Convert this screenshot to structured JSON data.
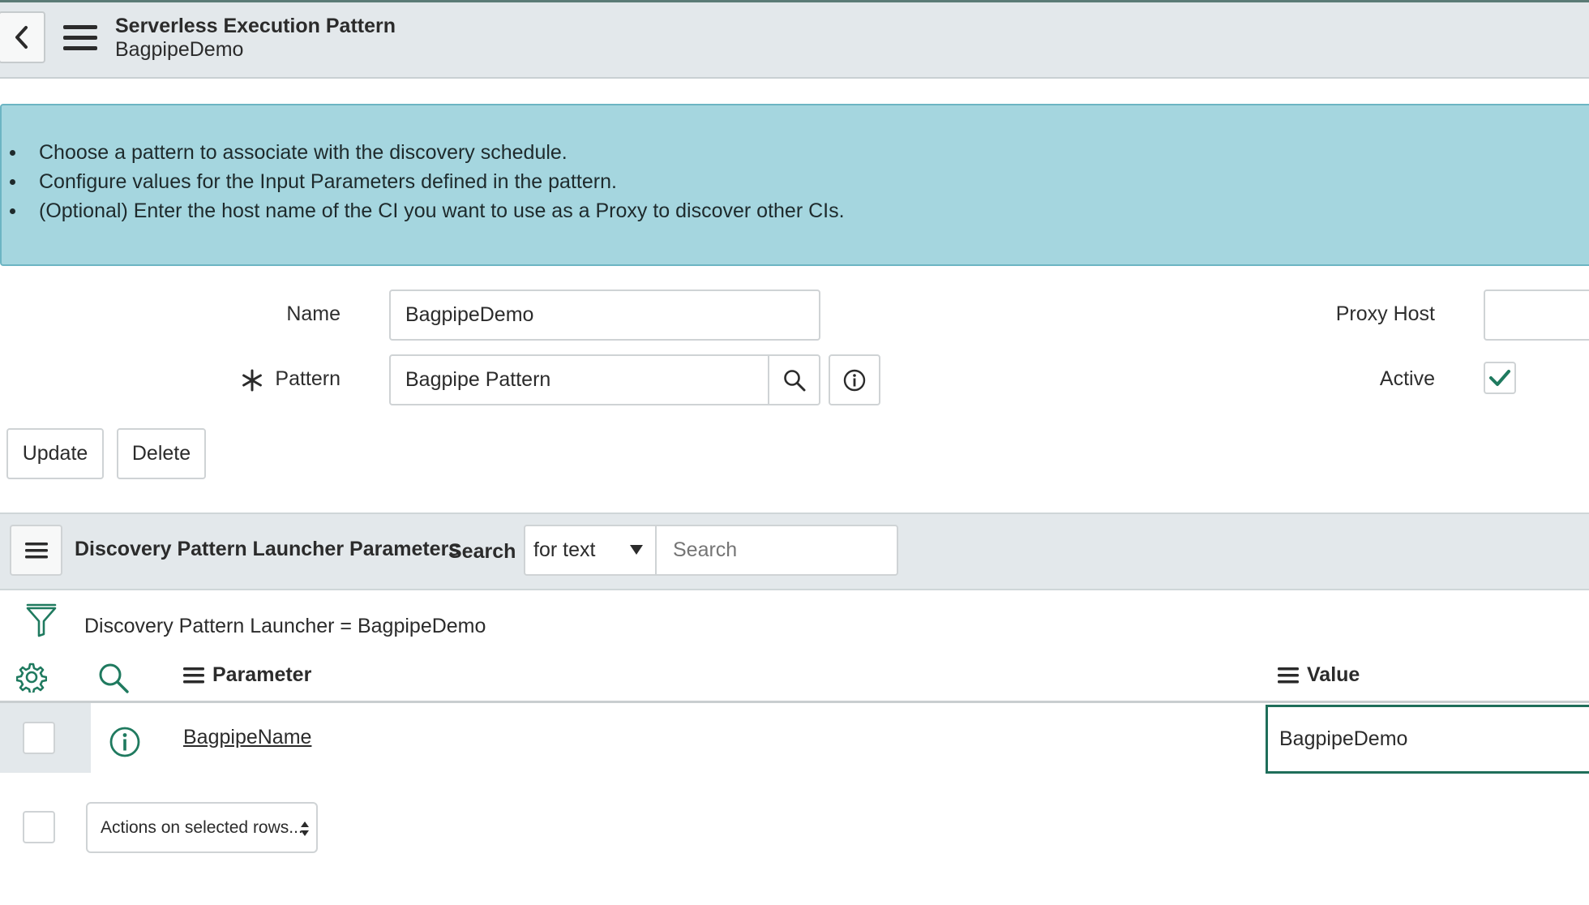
{
  "header": {
    "title": "Serverless Execution Pattern",
    "subtitle": "BagpipeDemo",
    "back_icon": "chevron-left-icon",
    "menu_icon": "hamburger-icon"
  },
  "info_banner": {
    "items": [
      "Choose a pattern to associate with the discovery schedule.",
      "Configure values for the Input Parameters defined in the pattern.",
      "(Optional) Enter the host name of the CI you want to use as a Proxy to discover other CIs."
    ]
  },
  "form": {
    "name_label": "Name",
    "name_value": "BagpipeDemo",
    "pattern_label": "Pattern",
    "pattern_value": "Bagpipe Pattern",
    "proxy_host_label": "Proxy Host",
    "proxy_host_value": "",
    "active_label": "Active",
    "active_checked": true
  },
  "buttons": {
    "update": "Update",
    "delete": "Delete"
  },
  "related_list": {
    "title": "Discovery Pattern Launcher Parameters",
    "search_label": "Search",
    "search_field_option": "for text",
    "search_placeholder": "Search",
    "filter_text": "Discovery Pattern Launcher = BagpipeDemo",
    "columns": [
      "Parameter",
      "Value"
    ],
    "rows": [
      {
        "parameter": "BagpipeName",
        "value": "BagpipeDemo"
      }
    ],
    "actions_select": "Actions on selected rows..."
  },
  "colors": {
    "header_bg": "#e3e8eb",
    "banner_bg": "#a5d6df",
    "accent": "#1f7a5f"
  }
}
